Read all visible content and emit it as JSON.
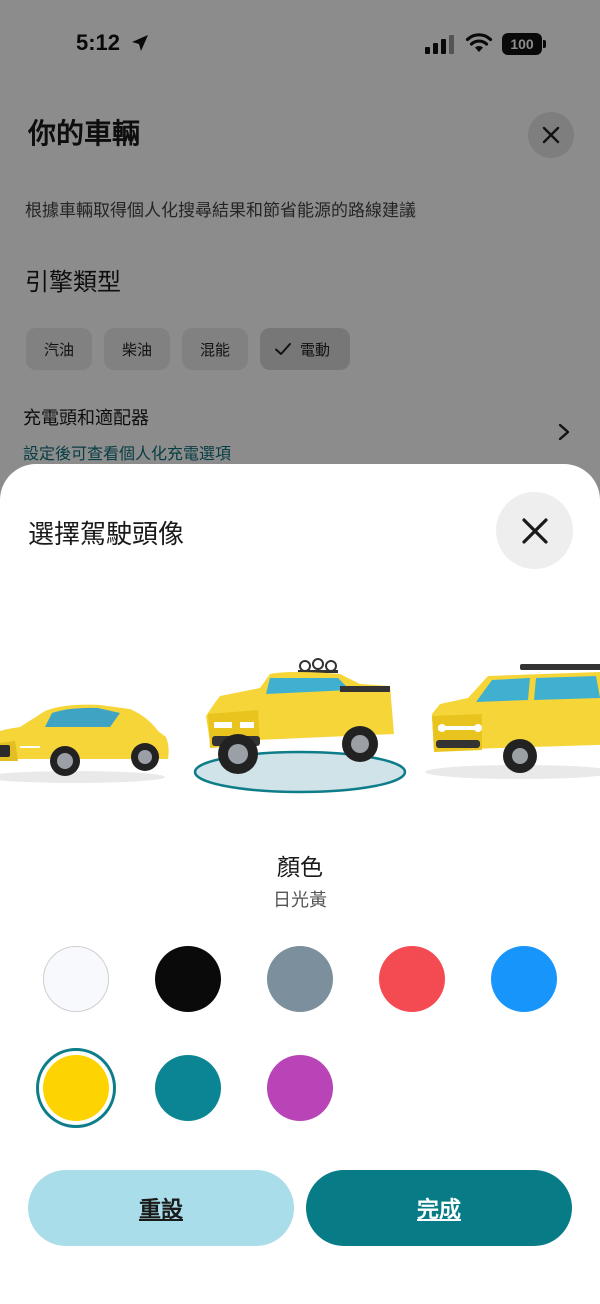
{
  "status_bar": {
    "time": "5:12",
    "battery": "100"
  },
  "background": {
    "title": "你的車輛",
    "subtitle": "根據車輛取得個人化搜尋結果和節省能源的路線建議",
    "section_title": "引擎類型",
    "engine_chips": [
      {
        "label": "汽油",
        "selected": false
      },
      {
        "label": "柴油",
        "selected": false
      },
      {
        "label": "混能",
        "selected": false
      },
      {
        "label": "電動",
        "selected": true
      }
    ],
    "charger_row": {
      "title": "充電頭和適配器",
      "subtitle": "設定後可查看個人化充電選項"
    }
  },
  "sheet": {
    "title": "選擇駕駛頭像",
    "cars": [
      "sedan",
      "pickup-truck",
      "suv"
    ],
    "selected_car": "pickup-truck",
    "color_label": "顏色",
    "selected_color_name": "日光黃",
    "colors": [
      {
        "name": "white",
        "hex": "#f8f9fd"
      },
      {
        "name": "black",
        "hex": "#0a0a0a"
      },
      {
        "name": "gray",
        "hex": "#7b8f9c"
      },
      {
        "name": "red",
        "hex": "#f44b53"
      },
      {
        "name": "blue",
        "hex": "#1895fa"
      },
      {
        "name": "yellow",
        "hex": "#fdd302",
        "selected": true
      },
      {
        "name": "teal",
        "hex": "#0b8593"
      },
      {
        "name": "purple",
        "hex": "#b944b8"
      }
    ],
    "reset_label": "重設",
    "done_label": "完成"
  }
}
